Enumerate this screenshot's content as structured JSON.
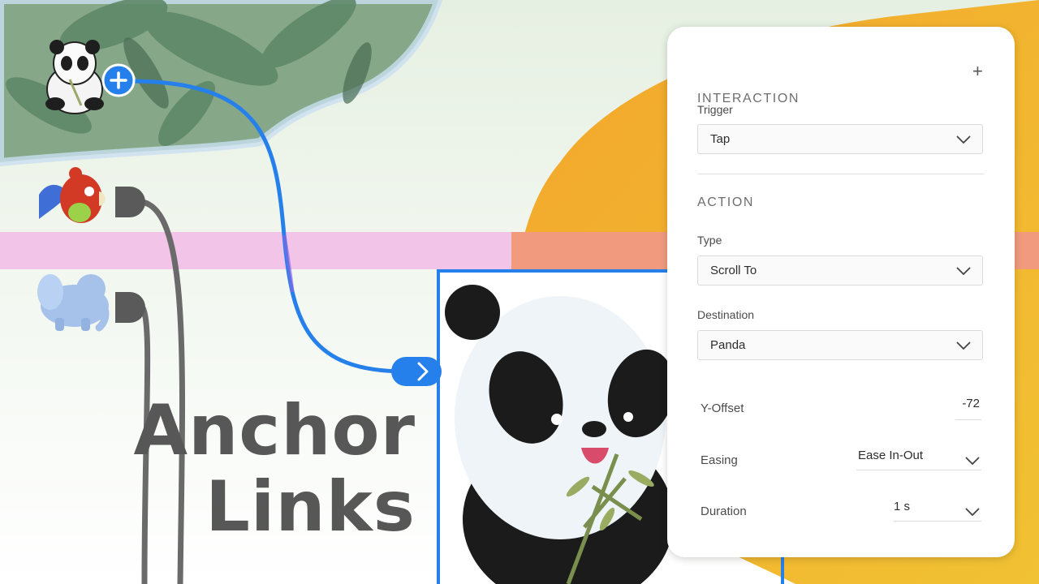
{
  "title": {
    "line1": "Anchor",
    "line2": "Links"
  },
  "canvas": {
    "artboards": [
      "panda-thumbnail",
      "parrot-thumbnail",
      "elephant-thumbnail",
      "panda-artboard"
    ],
    "colors": {
      "wire_active": "#2680eb",
      "wire_idle": "#6a6a6a",
      "band": "#f2c4e8",
      "orange": "#f0a632"
    }
  },
  "panel": {
    "interaction_label": "INTERACTION",
    "trigger": {
      "label": "Trigger",
      "value": "Tap"
    },
    "action_label": "ACTION",
    "type": {
      "label": "Type",
      "value": "Scroll To"
    },
    "destination": {
      "label": "Destination",
      "value": "Panda"
    },
    "y_offset": {
      "label": "Y-Offset",
      "value": "-72"
    },
    "easing": {
      "label": "Easing",
      "value": "Ease In-Out"
    },
    "duration": {
      "label": "Duration",
      "value": "1 s"
    }
  }
}
